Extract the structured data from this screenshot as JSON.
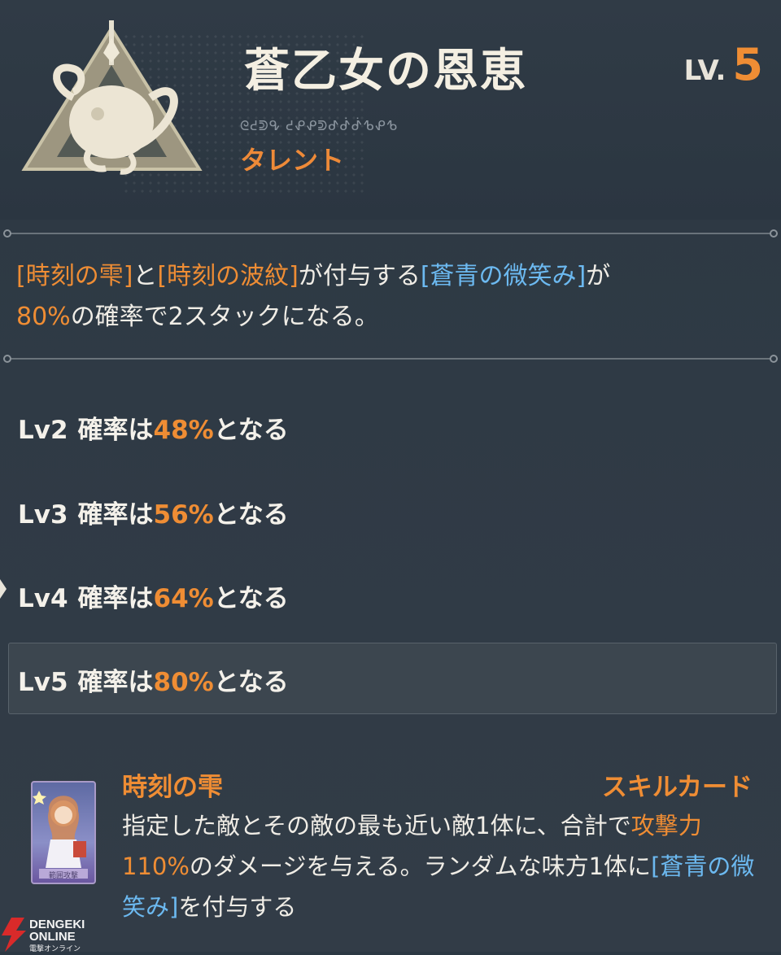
{
  "header": {
    "title": "蒼乙女の恩恵",
    "level_label": "LV.",
    "level_value": "5",
    "glyph_text": "ᘓᕍᕲᕴ ᕍᕵᕵᕲᕷᕸᕸᕹᕵᕹ",
    "subtitle": "タレント",
    "emblem_icon": "talent-emblem-icon"
  },
  "description": {
    "part1": "[時刻の雫]",
    "part2": "と",
    "part3": "[時刻の波紋]",
    "part4": "が付与する",
    "part5": "[蒼青の微笑み]",
    "part6": "が",
    "part7": "80%",
    "part8": "の確率で2スタックになる。"
  },
  "levels": [
    {
      "lv": "Lv2",
      "prefix": "確率は",
      "value": "48%",
      "suffix": "となる"
    },
    {
      "lv": "Lv3",
      "prefix": "確率は",
      "value": "56%",
      "suffix": "となる"
    },
    {
      "lv": "Lv4",
      "prefix": "確率は",
      "value": "64%",
      "suffix": "となる"
    },
    {
      "lv": "Lv5",
      "prefix": "確率は",
      "value": "80%",
      "suffix": "となる"
    }
  ],
  "skill_card": {
    "name": "時刻の雫",
    "type": "スキルカード",
    "desc1": "指定した敵とその敵の最も近い敵1体に、合計で",
    "desc2": "攻撃力110%",
    "desc3": "のダメージを与える。ランダムな味方1体に",
    "desc4": "[蒼青の微笑み]",
    "desc5": "を付与する",
    "card_label": "範囲攻撃",
    "card_icon": "skill-card-portrait"
  },
  "watermark": {
    "line1": "DENGEKI",
    "line2": "ONLINE",
    "line3": "電撃オンライン"
  },
  "colors": {
    "accent_orange": "#ef8d34",
    "accent_blue": "#6cb9f0",
    "background": "#2f3a45"
  }
}
